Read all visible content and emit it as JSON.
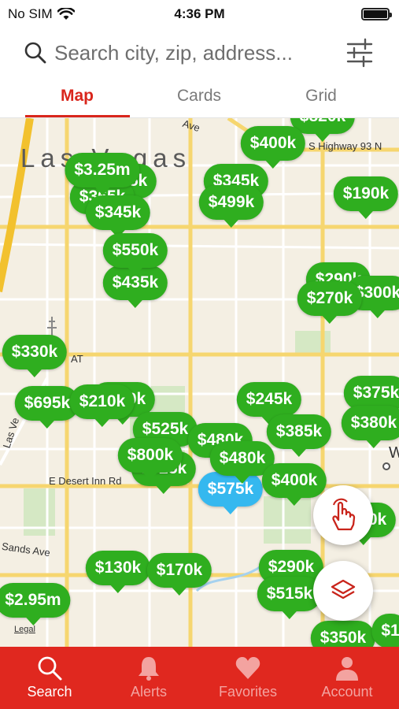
{
  "status_bar": {
    "carrier": "No SIM",
    "time": "4:36 PM",
    "battery_level": 1.0
  },
  "search": {
    "placeholder": "Search city, zip, address..."
  },
  "tabs": [
    {
      "label": "Map",
      "active": true
    },
    {
      "label": "Cards",
      "active": false
    },
    {
      "label": "Grid",
      "active": false
    }
  ],
  "map": {
    "city_label": "Las Vegas",
    "road_labels": {
      "ave_top": "Ave",
      "highway": "S Highway 93 N",
      "desert_inn": "E Desert Inn Rd",
      "sands": "Sands Ave",
      "vegas_blvd": "Las Ve",
      "at": "AT",
      "w": "W"
    },
    "legal": "Legal",
    "pins": [
      {
        "label": "$820k"
      },
      {
        "label": "$400k"
      },
      {
        "label": "$3.25m"
      },
      {
        "label": "$345k"
      },
      {
        "label": "$499k"
      },
      {
        "label": "$190k"
      },
      {
        "label": "$365k"
      },
      {
        "label": "$550k"
      },
      {
        "label": "$435k"
      },
      {
        "label": "$290k"
      },
      {
        "label": "$270k"
      },
      {
        "label": "$300k"
      },
      {
        "label": "$330k"
      },
      {
        "label": "$695k"
      },
      {
        "label": "$210k"
      },
      {
        "label": "$245k"
      },
      {
        "label": "$375k"
      },
      {
        "label": "$525k"
      },
      {
        "label": "$385k"
      },
      {
        "label": "$380k"
      },
      {
        "label": "$800k"
      },
      {
        "label": "$480k"
      },
      {
        "label": "$400k"
      },
      {
        "label": "$575k"
      },
      {
        "label": "$130k"
      },
      {
        "label": "$170k"
      },
      {
        "label": "$290k"
      },
      {
        "label": "$2.95m"
      },
      {
        "label": "$515k"
      },
      {
        "label": "$350k"
      },
      {
        "label": "$1"
      }
    ]
  },
  "bottom_nav": [
    {
      "label": "Search",
      "icon": "search-icon",
      "active": true
    },
    {
      "label": "Alerts",
      "icon": "bell-icon",
      "active": false
    },
    {
      "label": "Favorites",
      "icon": "heart-icon",
      "active": false
    },
    {
      "label": "Account",
      "icon": "person-icon",
      "active": false
    }
  ],
  "colors": {
    "accent": "#d9261c",
    "pin_green": "#2fae1f",
    "pin_blue": "#35b8ef",
    "nav_bg": "#e0281f"
  }
}
